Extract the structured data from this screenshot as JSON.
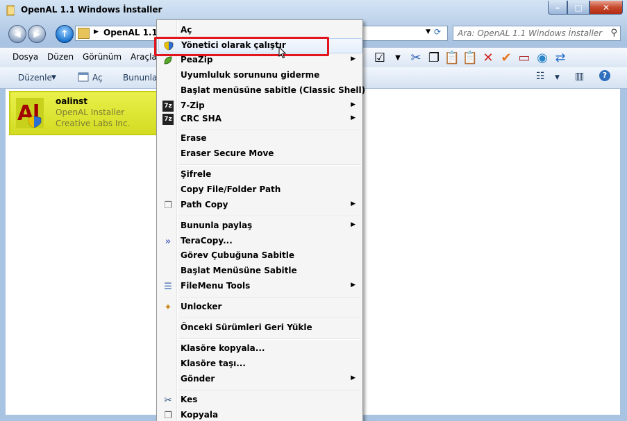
{
  "window": {
    "title": "OpenAL 1.1 Windows İnstaller",
    "min_glyph": "–",
    "max_glyph": "□",
    "close_glyph": "✕"
  },
  "nav": {
    "back_glyph": "◀",
    "forward_glyph": "▶",
    "up_glyph": "↑",
    "address": "OpenAL 1.1 W",
    "search_placeholder": "Ara: OpenAL 1.1 Windows İnstaller"
  },
  "menubar": {
    "items": [
      "Dosya",
      "Düzen",
      "Görünüm",
      "Araçla"
    ]
  },
  "cmdbar": {
    "organize": "Düzenle",
    "open": "Aç",
    "share": "Bununla"
  },
  "file": {
    "name": "oalinst",
    "description": "OpenAL Installer",
    "company": "Creative Labs Inc."
  },
  "context_menu": {
    "items": [
      {
        "label": "Aç",
        "icon": "",
        "submenu": false
      },
      {
        "label": "Yönetici olarak çalıştır",
        "icon": "uac-shield-icon",
        "submenu": false
      },
      {
        "label": "PeaZip",
        "icon": "peazip-icon",
        "submenu": true
      },
      {
        "label": "Uyumluluk sorununu giderme",
        "icon": "",
        "submenu": false
      },
      {
        "label": "Başlat menüsüne sabitle (Classic Shell)",
        "icon": "",
        "submenu": false
      },
      {
        "label": "7-Zip",
        "icon": "7zip-icon",
        "submenu": true
      },
      {
        "label": "CRC SHA",
        "icon": "7zip-icon",
        "submenu": true
      },
      {
        "label": "Erase",
        "icon": "",
        "submenu": false
      },
      {
        "label": "Eraser Secure Move",
        "icon": "",
        "submenu": false
      },
      {
        "label": "Şifrele",
        "icon": "",
        "submenu": false
      },
      {
        "label": "Copy File/Folder Path",
        "icon": "",
        "submenu": false
      },
      {
        "label": "Path Copy",
        "icon": "path-copy-icon",
        "submenu": true
      },
      {
        "label": "Bununla paylaş",
        "icon": "",
        "submenu": true
      },
      {
        "label": "TeraCopy...",
        "icon": "teracopy-icon",
        "submenu": false
      },
      {
        "label": "Görev Çubuğuna Sabitle",
        "icon": "",
        "submenu": false
      },
      {
        "label": "Başlat Menüsüne Sabitle",
        "icon": "",
        "submenu": false
      },
      {
        "label": "FileMenu Tools",
        "icon": "filemenu-tools-icon",
        "submenu": true
      },
      {
        "label": "Unlocker",
        "icon": "unlocker-wand-icon",
        "submenu": false
      },
      {
        "label": "Önceki Sürümleri Geri Yükle",
        "icon": "",
        "submenu": false
      },
      {
        "label": "Klasöre kopyala...",
        "icon": "",
        "submenu": false
      },
      {
        "label": "Klasöre taşı...",
        "icon": "",
        "submenu": false
      },
      {
        "label": "Gönder",
        "icon": "",
        "submenu": true
      },
      {
        "label": "Kes",
        "icon": "scissors-icon",
        "submenu": false
      },
      {
        "label": "Kopyala",
        "icon": "copy-icon",
        "submenu": false
      }
    ]
  },
  "colors": {
    "highlight_border": "#e3141b",
    "selection": "#e1ea3a"
  }
}
